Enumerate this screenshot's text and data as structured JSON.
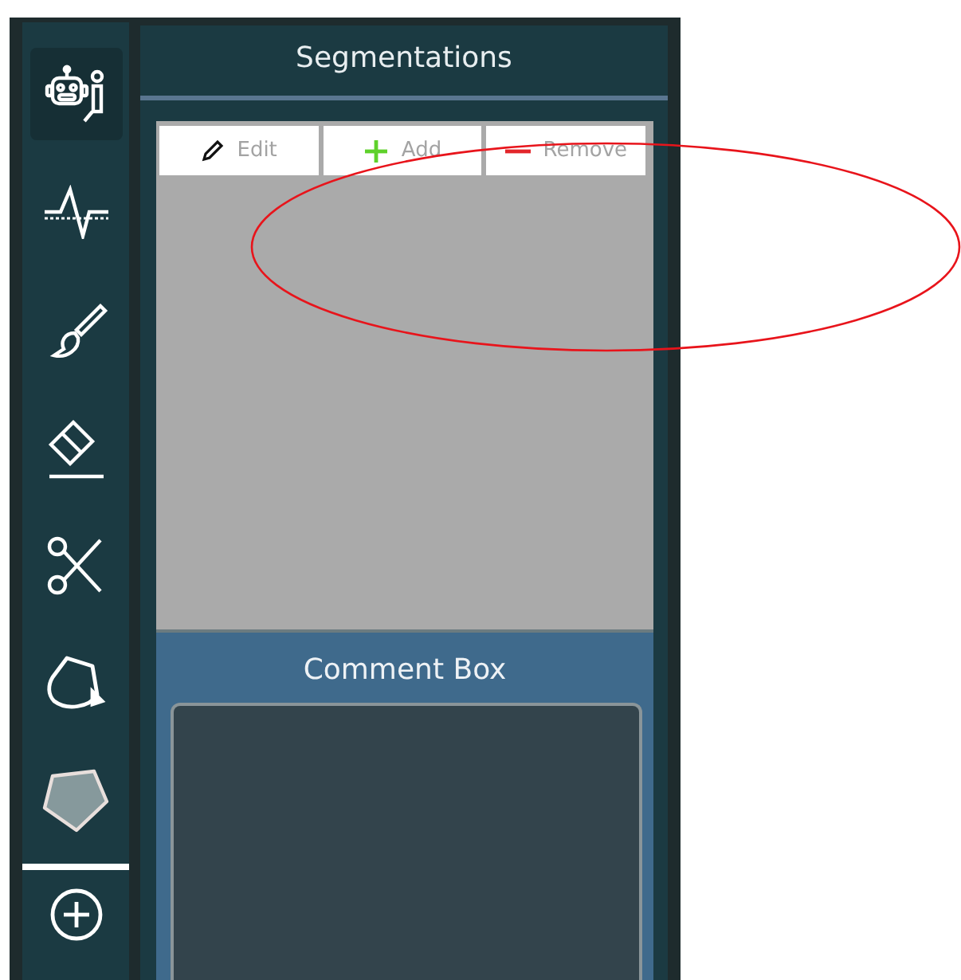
{
  "toolbar": {
    "tools": [
      {
        "kind": "robot",
        "selected": true
      },
      {
        "kind": "pulse",
        "selected": false
      },
      {
        "kind": "brush",
        "selected": false
      },
      {
        "kind": "eraser",
        "selected": false
      },
      {
        "kind": "scissors",
        "selected": false
      },
      {
        "kind": "bucket",
        "selected": false
      },
      {
        "kind": "polygon",
        "selected": false
      },
      {
        "kind": "add",
        "selected": false
      }
    ]
  },
  "segmentations": {
    "title": "Segmentations",
    "buttons": [
      {
        "kind": "edit",
        "label": "Edit"
      },
      {
        "kind": "add",
        "label": "Add"
      },
      {
        "kind": "remove",
        "label": "Remove"
      }
    ]
  },
  "comment_box": {
    "title": "Comment Box"
  },
  "annotation": {
    "kind": "ellipse",
    "color": "#e8141b"
  }
}
